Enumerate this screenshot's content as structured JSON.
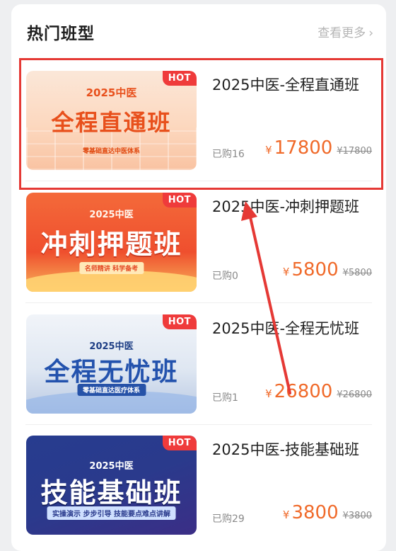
{
  "header": {
    "title": "热门班型",
    "more_label": "查看更多",
    "more_icon": "chevron-right-icon"
  },
  "courses": [
    {
      "name": "2025中医-全程直通班",
      "sold": "已购16",
      "price": "17800",
      "original_price": "¥17800",
      "badge": "HOT",
      "thumb": {
        "year": "2025中医",
        "title": "全程直通班",
        "subtitle": "零基础直达中医体系"
      }
    },
    {
      "name": "2025中医-冲刺押题班",
      "sold": "已购0",
      "price": "5800",
      "original_price": "¥5800",
      "badge": "HOT",
      "thumb": {
        "year": "2025中医",
        "title": "冲刺押题班",
        "subtitle": "名师精讲 科学备考"
      }
    },
    {
      "name": "2025中医-全程无忧班",
      "sold": "已购1",
      "price": "26800",
      "original_price": "¥26800",
      "badge": "HOT",
      "thumb": {
        "year": "2025中医",
        "title": "全程无忧班",
        "subtitle": "零基础直达医疗体系"
      }
    },
    {
      "name": "2025中医-技能基础班",
      "sold": "已购29",
      "price": "3800",
      "original_price": "¥3800",
      "badge": "HOT",
      "thumb": {
        "year": "2025中医",
        "title": "技能基础班",
        "subtitle": "实操演示 步步引导 技能要点难点讲解"
      }
    }
  ],
  "currency_symbol": "¥",
  "colors": {
    "price": "#f06a2a",
    "hot_badge": "#ef3b3b",
    "annotation": "#e53935"
  }
}
